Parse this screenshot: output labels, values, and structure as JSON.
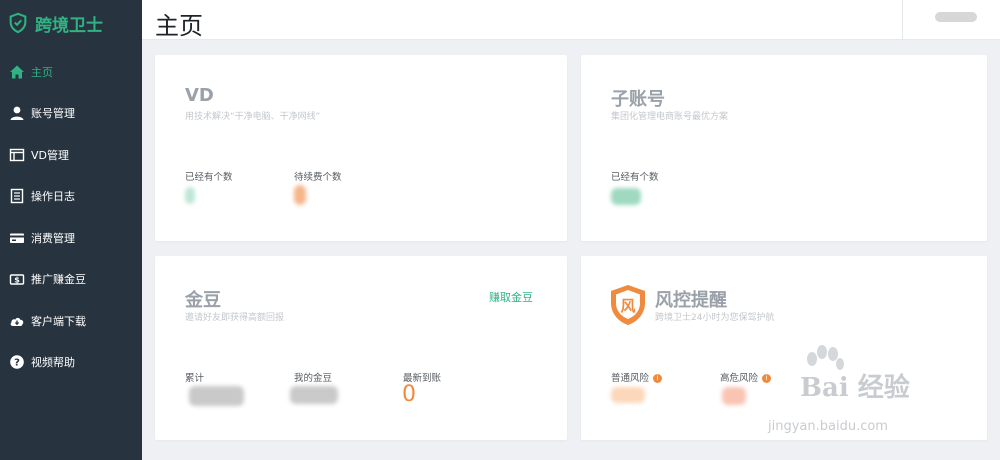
{
  "brand": {
    "name": "跨境卫士",
    "accent": "#2fb383"
  },
  "sidebar": {
    "items": [
      {
        "label": "主页",
        "icon": "home-icon",
        "active": true
      },
      {
        "label": "账号管理",
        "icon": "user-icon"
      },
      {
        "label": "VD管理",
        "icon": "window-icon"
      },
      {
        "label": "操作日志",
        "icon": "log-icon"
      },
      {
        "label": "消费管理",
        "icon": "card-icon"
      },
      {
        "label": "推广赚金豆",
        "icon": "promote-icon"
      },
      {
        "label": "客户端下载",
        "icon": "cloud-download-icon"
      },
      {
        "label": "视频帮助",
        "icon": "help-icon"
      }
    ]
  },
  "header": {
    "title": "主页"
  },
  "cards": {
    "vd": {
      "title": "VD",
      "subtitle": "用技术解决“干净电脑、干净网线”",
      "stats": [
        {
          "label": "已经有个数"
        },
        {
          "label": "待续费个数"
        }
      ]
    },
    "subaccount": {
      "title": "子账号",
      "subtitle": "集团化管理电商账号最优方案",
      "stats": [
        {
          "label": "已经有个数"
        }
      ]
    },
    "beans": {
      "title": "金豆",
      "subtitle": "邀请好友即获得高额回报",
      "link": "赚取金豆",
      "stats": [
        {
          "label": "累计"
        },
        {
          "label": "我的金豆"
        },
        {
          "label": "最新到账",
          "value": "0"
        }
      ]
    },
    "risk": {
      "title": "风控提醒",
      "subtitle": "跨境卫士24小时为您保驾护航",
      "badge_char": "风",
      "stats": [
        {
          "label": "普通风险",
          "info": "i"
        },
        {
          "label": "高危风险",
          "info": "i"
        }
      ]
    }
  },
  "watermark": {
    "main": "Bai 经验",
    "sub": "jingyan.baidu.com"
  }
}
